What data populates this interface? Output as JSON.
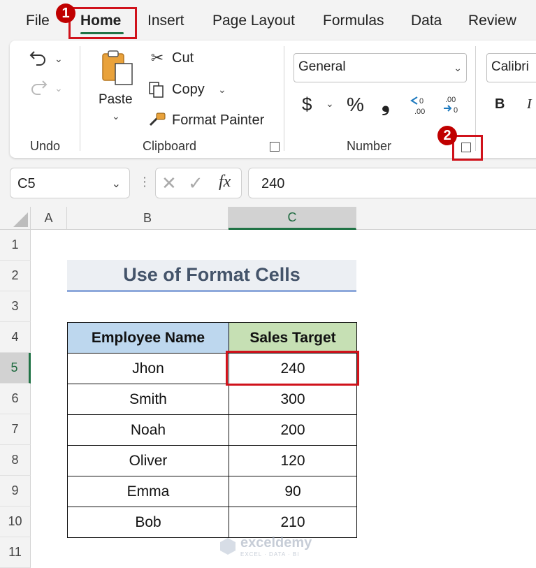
{
  "menu": {
    "tabs": [
      "File",
      "Home",
      "Insert",
      "Page Layout",
      "Formulas",
      "Data",
      "Review"
    ]
  },
  "badges": [
    "1",
    "2"
  ],
  "ribbon": {
    "groups": {
      "undo": "Undo",
      "clipboard": "Clipboard",
      "number": "Number"
    },
    "paste_label": "Paste",
    "cut_label": "Cut",
    "copy_label": "Copy",
    "format_painter_label": "Format Painter",
    "number_format": "General",
    "font_name": "Calibri",
    "currency_symbol": "$",
    "percent_symbol": "%",
    "comma_symbol": "❟",
    "bold_label": "B",
    "italic_label": "I"
  },
  "formula_bar": {
    "name_box": "C5",
    "fx_label": "fx",
    "value": "240"
  },
  "sheet": {
    "columns": [
      "A",
      "B",
      "C"
    ],
    "selected_column": "C",
    "rows": [
      "1",
      "2",
      "3",
      "4",
      "5",
      "6",
      "7",
      "8",
      "9",
      "10",
      "11"
    ],
    "selected_row": "5",
    "title": "Use of Format Cells",
    "headers": [
      "Employee Name",
      "Sales Target"
    ],
    "records": [
      {
        "name": "Jhon",
        "target": "240"
      },
      {
        "name": "Smith",
        "target": "300"
      },
      {
        "name": "Noah",
        "target": "200"
      },
      {
        "name": "Oliver",
        "target": "120"
      },
      {
        "name": "Emma",
        "target": "90"
      },
      {
        "name": "Bob",
        "target": "210"
      }
    ]
  },
  "watermark": {
    "name": "exceldemy",
    "tagline": "EXCEL · DATA · BI"
  },
  "colors": {
    "accent": "#217346",
    "highlight_red": "#d0121b",
    "header_blue": "#bdd7ee",
    "header_green": "#c6e0b4",
    "title_text": "#44546a"
  }
}
